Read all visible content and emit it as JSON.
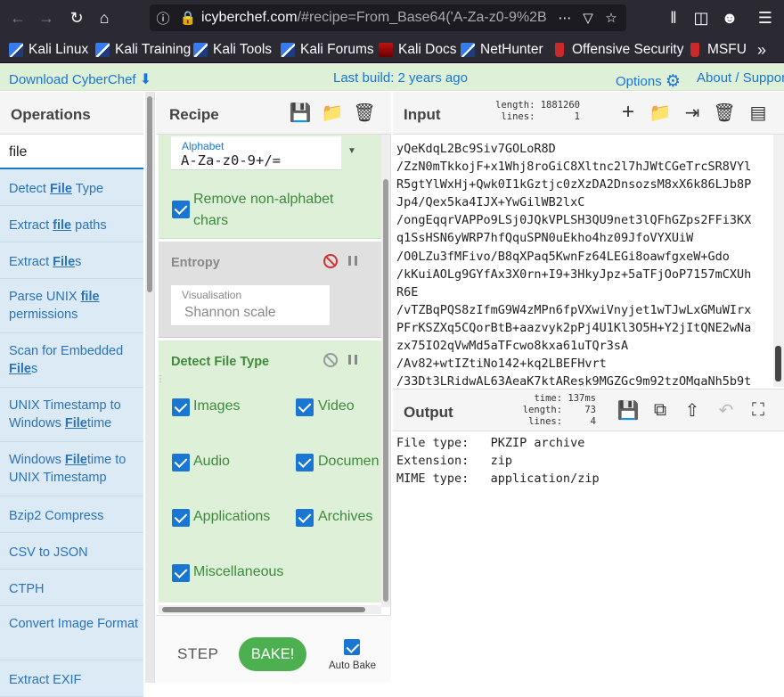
{
  "browser": {
    "url_host": "icyberchef.com",
    "url_rest": "/#recipe=From_Base64('A-Za-z0-9%2B",
    "bookmarks": [
      "Kali Linux",
      "Kali Training",
      "Kali Tools",
      "Kali Forums",
      "Kali Docs",
      "NetHunter",
      "Offensive Security",
      "MSFU"
    ]
  },
  "banner": {
    "download": "Download CyberChef",
    "last_build": "Last build: 2 years ago",
    "options": "Options",
    "about": "About / Support"
  },
  "operations": {
    "title": "Operations",
    "search_value": "file",
    "items": [
      {
        "pre": "Detect ",
        "match": "File",
        "post": " Type"
      },
      {
        "pre": "Extract ",
        "match": "file",
        "post": " paths"
      },
      {
        "pre": "Extract ",
        "match": "File",
        "post": "s"
      },
      {
        "pre": "Parse UNIX ",
        "match": "file",
        "post": " permissions"
      },
      {
        "pre": "Scan for Embedded ",
        "match": "File",
        "post": "s"
      },
      {
        "pre": "UNIX Timestamp to Windows ",
        "match": "File",
        "post": "time"
      },
      {
        "pre": "Windows ",
        "match": "File",
        "post": "time to UNIX Timestamp"
      },
      {
        "pre": "Bzip2 Compress",
        "match": "",
        "post": ""
      },
      {
        "pre": "CSV to JSON",
        "match": "",
        "post": ""
      },
      {
        "pre": "CTPH",
        "match": "",
        "post": ""
      },
      {
        "pre": "Convert Image Format",
        "match": "",
        "post": ""
      },
      {
        "pre": "Extract EXIF",
        "match": "",
        "post": ""
      }
    ]
  },
  "recipe": {
    "title": "Recipe",
    "from_base64": {
      "alphabet_label": "Alphabet",
      "alphabet_value": "A-Za-z0-9+/=",
      "remove_label": "Remove non-alphabet chars"
    },
    "entropy": {
      "title": "Entropy",
      "vis_label": "Visualisation",
      "vis_value": "Shannon scale"
    },
    "detect": {
      "title": "Detect File Type",
      "options": [
        "Images",
        "Video",
        "Audio",
        "Documen",
        "Applications",
        "Archives",
        "Miscellaneous"
      ]
    },
    "step": "STEP",
    "bake": "BAKE!",
    "auto_bake": "Auto Bake"
  },
  "input": {
    "title": "Input",
    "length_label": "length:",
    "length": "1881260",
    "lines_label": "lines:",
    "lines": "1",
    "text": "yQeKdqL2Bc9Siv7GOLoR8D\n/ZzN0mTkkojF+x1Whj8roGiC8Xltnc2l7hJWtCGeTrcSR8VYl\nR5gtYlWxHj+Qwk0I1kGztjc0zXzDA2DnsozsM8xX6k86LJb8P\nJp4/Qex5ka4IJX+YwGilWB2lxC\n/ongEqqrVAPPo9LSj0JQkVPLSH3QU9net3lQFhGZps2FFi3KX\nq1SsHSN6yWRP7hfQquSPN0uEkho4hz09JfoVYXUiW\n/O0LZu3fMFivo/B8qXPaq5KwnFz64LEGi8oawfgxeW+Gdo\n/kKuiAOLg9GYfAx3X0rn+I9+3HkyJpz+5aTFjOoP7157mCXUh\nR6E\n/vTZBqPQS8zIfmG9W4zMPn6fpVXwiVnyjet1wTJwLxGMuWIrx\nPFrKSZXq5CQorBtB+aazvyk2pPj4U1Kl3O5H+Y2jItQNE2wNa\nzx75IO2qVwMd5aTFcwo8kxa61uTQr3sA\n/Av82+wtIZtiNo142+kq2LBEFHvrt\n/33Dt3LRidwAL63AeaK7ktAResk9MGZGc9m92tzOMgaNh5b9t"
  },
  "output": {
    "title": "Output",
    "time_label": "time:",
    "time": "137ms",
    "length_label": "length:",
    "length": "73",
    "lines_label": "lines:",
    "lines": "4",
    "text": "File type:   PKZIP archive\nExtension:   zip\nMIME type:   application/zip"
  }
}
